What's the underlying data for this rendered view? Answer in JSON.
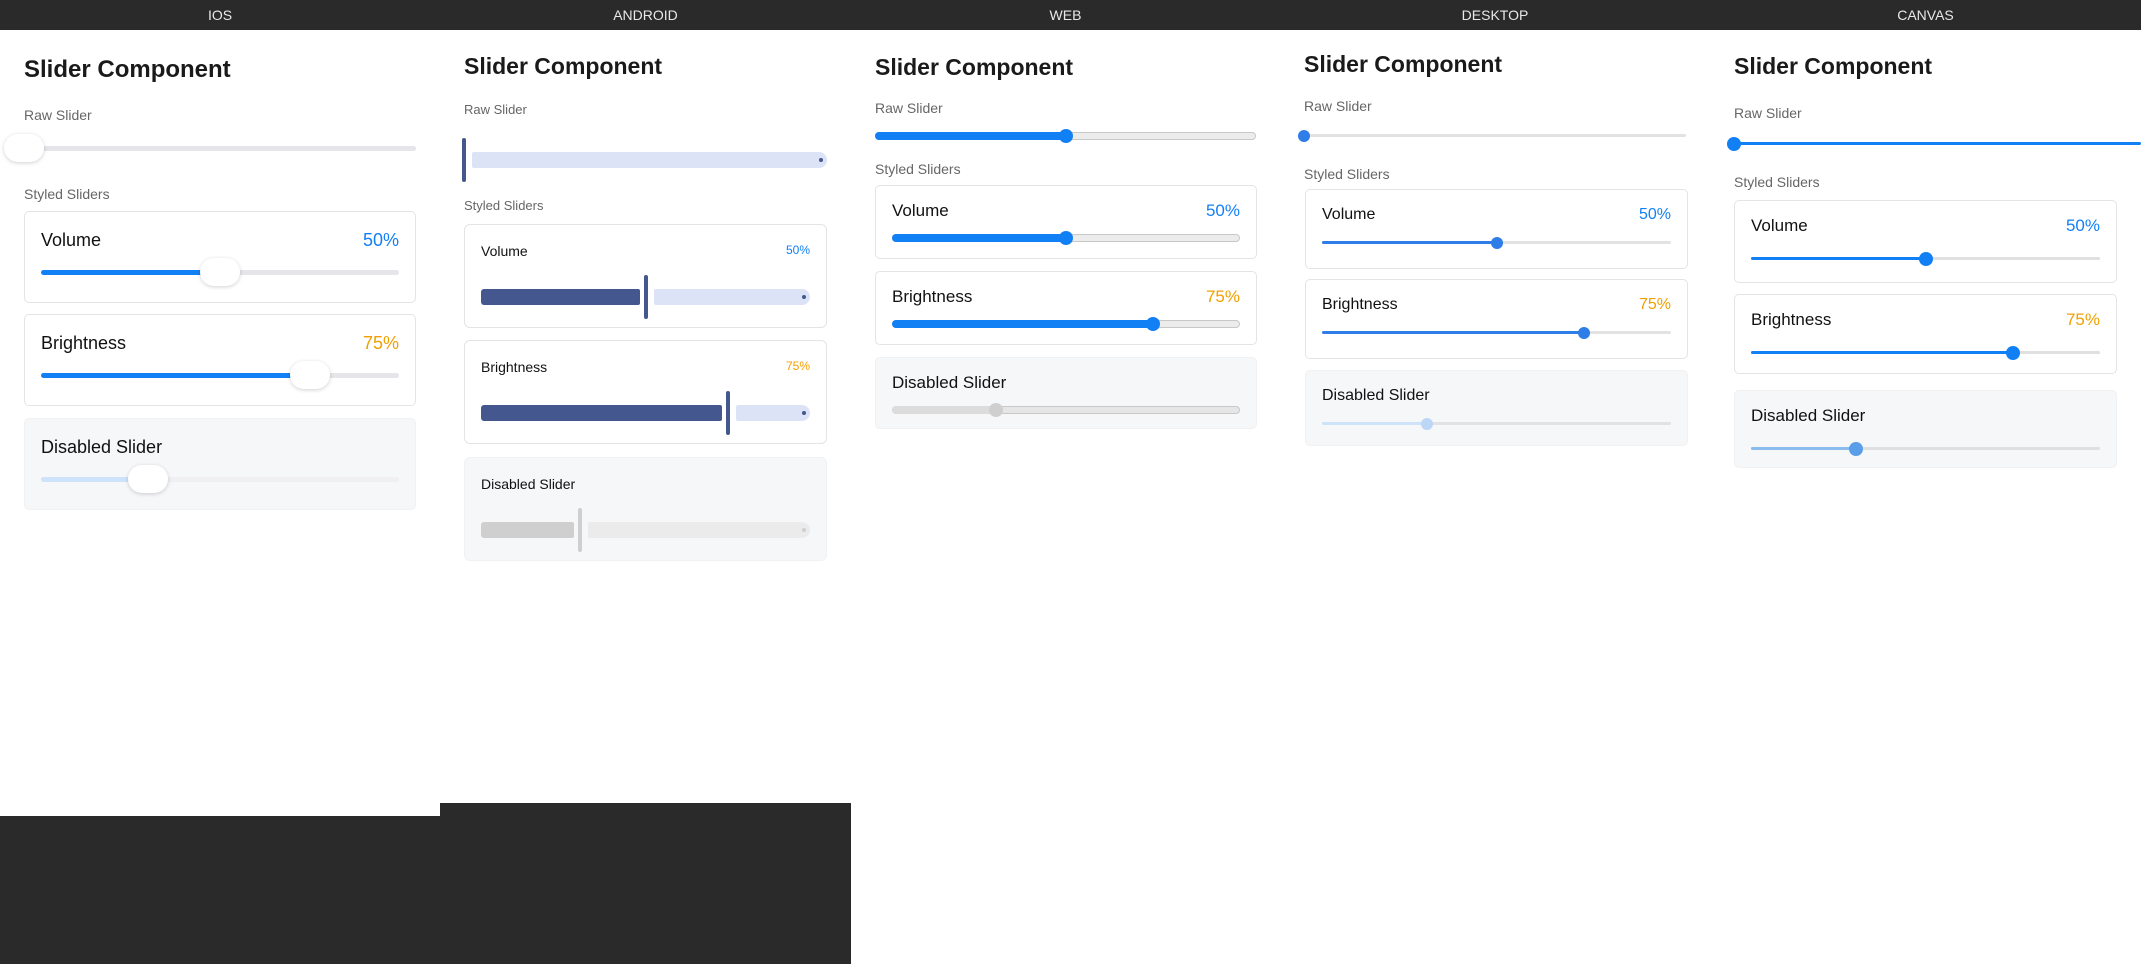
{
  "platform_tabs": [
    {
      "label": "IOS"
    },
    {
      "label": "ANDROID"
    },
    {
      "label": "WEB"
    },
    {
      "label": "DESKTOP"
    },
    {
      "label": "CANVAS"
    }
  ],
  "colors": {
    "header_bg": "#2a2a2a",
    "accent_blue": "#1280f5",
    "accent_orange": "#f0a000",
    "android_fill": "#44578e",
    "android_track": "#dde3f7",
    "disabled_track": "#cfe2fb"
  },
  "panels": [
    {
      "title": "Slider Component",
      "raw_label": "Raw Slider",
      "raw_value": 0,
      "styled_label": "Styled Sliders",
      "sliders": [
        {
          "name": "Volume",
          "value_text": "50%",
          "value": 0.5,
          "state": "enabled"
        },
        {
          "name": "Brightness",
          "value_text": "75%",
          "value": 0.75,
          "state": "enabled"
        },
        {
          "name": "Disabled Slider",
          "value": 0.3,
          "state": "disabled"
        }
      ]
    },
    {
      "title": "Slider Component",
      "raw_label": "Raw Slider",
      "raw_value": 0,
      "styled_label": "Styled Sliders",
      "sliders": [
        {
          "name": "Volume",
          "value_text": "50%",
          "value": 0.5,
          "state": "enabled"
        },
        {
          "name": "Brightness",
          "value_text": "75%",
          "value": 0.75,
          "state": "enabled"
        },
        {
          "name": "Disabled Slider",
          "value": 0.3,
          "state": "disabled"
        }
      ]
    },
    {
      "title": "Slider Component",
      "raw_label": "Raw Slider",
      "raw_value": 0.5,
      "styled_label": "Styled Sliders",
      "sliders": [
        {
          "name": "Volume",
          "value_text": "50%",
          "value": 0.5,
          "state": "enabled"
        },
        {
          "name": "Brightness",
          "value_text": "75%",
          "value": 0.75,
          "state": "enabled"
        },
        {
          "name": "Disabled Slider",
          "value": 0.3,
          "state": "disabled"
        }
      ]
    },
    {
      "title": "Slider Component",
      "raw_label": "Raw Slider",
      "raw_value": 0,
      "styled_label": "Styled Sliders",
      "sliders": [
        {
          "name": "Volume",
          "value_text": "50%",
          "value": 0.5,
          "state": "enabled"
        },
        {
          "name": "Brightness",
          "value_text": "75%",
          "value": 0.75,
          "state": "enabled"
        },
        {
          "name": "Disabled Slider",
          "value": 0.3,
          "state": "disabled"
        }
      ]
    },
    {
      "title": "Slider Component",
      "raw_label": "Raw Slider",
      "raw_value": 0,
      "styled_label": "Styled Sliders",
      "sliders": [
        {
          "name": "Volume",
          "value_text": "50%",
          "value": 0.5,
          "state": "enabled"
        },
        {
          "name": "Brightness",
          "value_text": "75%",
          "value": 0.75,
          "state": "enabled"
        },
        {
          "name": "Disabled Slider",
          "value": 0.3,
          "state": "disabled"
        }
      ]
    }
  ]
}
